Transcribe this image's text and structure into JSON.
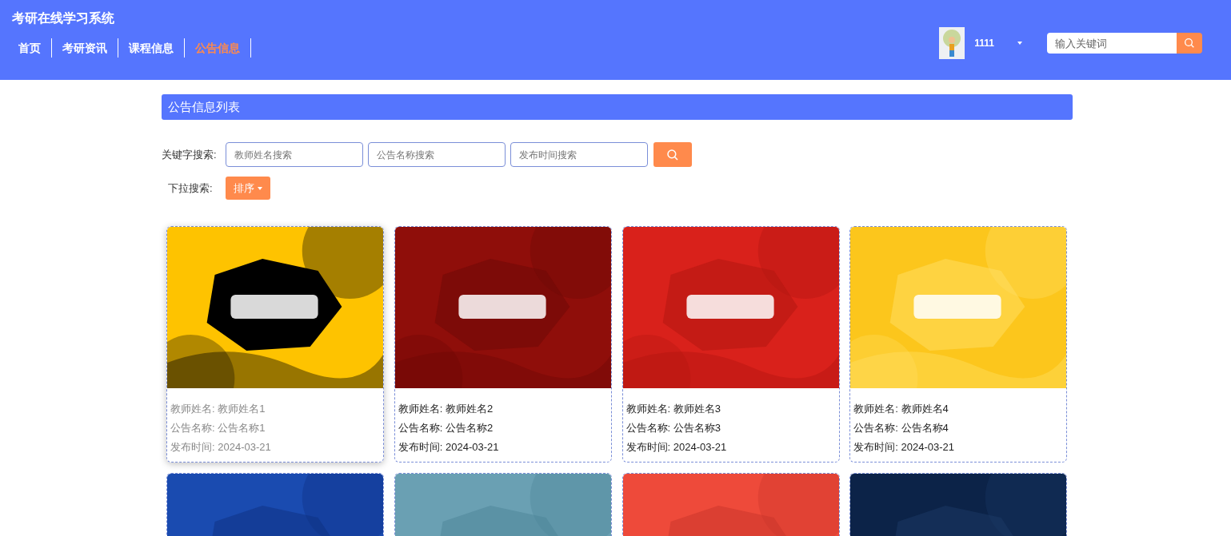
{
  "header": {
    "title": "考研在线学习系统",
    "nav": [
      {
        "label": "首页",
        "selected": false
      },
      {
        "label": "考研资讯",
        "selected": false
      },
      {
        "label": "课程信息",
        "selected": false
      },
      {
        "label": "公告信息",
        "selected": true
      }
    ],
    "user": {
      "name": "1111"
    },
    "search": {
      "placeholder": "输入关键词"
    }
  },
  "section": {
    "title": "公告信息列表"
  },
  "filters": {
    "keyword_label": "关键字搜索:",
    "fields": [
      {
        "placeholder": "教师姓名搜索"
      },
      {
        "placeholder": "公告名称搜索"
      },
      {
        "placeholder": "发布时间搜索"
      }
    ],
    "dropdown_label": "下拉搜索:",
    "sort_button": "排序"
  },
  "cards": [
    {
      "picture": {
        "kind": "picture"
      },
      "hovered": true,
      "lines": [
        {
          "label": "教师姓名:",
          "value": "教师姓名1"
        },
        {
          "label": "公告名称:",
          "value": "公告名称1"
        },
        {
          "label": "发布时间:",
          "value": "2024-03-21"
        }
      ]
    },
    {
      "picture": {
        "kind": "picture"
      },
      "hovered": false,
      "lines": [
        {
          "label": "教师姓名:",
          "value": "教师姓名2"
        },
        {
          "label": "公告名称:",
          "value": "公告名称2"
        },
        {
          "label": "发布时间:",
          "value": "2024-03-21"
        }
      ]
    },
    {
      "picture": {
        "kind": "picture"
      },
      "hovered": false,
      "lines": [
        {
          "label": "教师姓名:",
          "value": "教师姓名3"
        },
        {
          "label": "公告名称:",
          "value": "公告名称3"
        },
        {
          "label": "发布时间:",
          "value": "2024-03-21"
        }
      ]
    },
    {
      "picture": {
        "kind": "picture"
      },
      "hovered": false,
      "lines": [
        {
          "label": "教师姓名:",
          "value": "教师姓名4"
        },
        {
          "label": "公告名称:",
          "value": "公告名称4"
        },
        {
          "label": "发布时间:",
          "value": "2024-03-21"
        }
      ]
    },
    {
      "picture": {
        "kind": "picture"
      }
    },
    {
      "picture": {
        "kind": "picture"
      }
    },
    {
      "picture": {
        "kind": "picture"
      }
    },
    {
      "picture": {
        "kind": "picture"
      }
    }
  ]
}
